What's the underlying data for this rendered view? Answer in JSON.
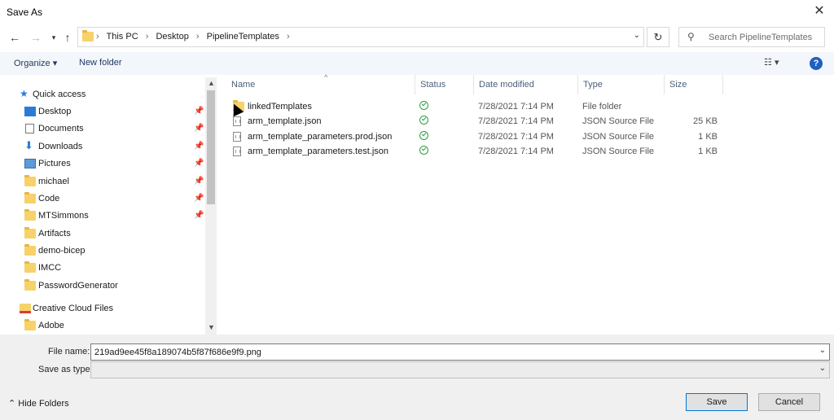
{
  "window": {
    "title": "Save As"
  },
  "navigation": {
    "breadcrumbs": [
      "This PC",
      "Desktop",
      "PipelineTemplates"
    ],
    "search_placeholder": "Search PipelineTemplates"
  },
  "toolbar": {
    "organize_label": "Organize",
    "new_folder_label": "New folder"
  },
  "sidebar": {
    "items": [
      {
        "label": "Quick access",
        "icon": "star-icon",
        "pinned": false
      },
      {
        "label": "Desktop",
        "icon": "desktop-icon",
        "pinned": true
      },
      {
        "label": "Documents",
        "icon": "documents-icon",
        "pinned": true
      },
      {
        "label": "Downloads",
        "icon": "downloads-icon",
        "pinned": true
      },
      {
        "label": "Pictures",
        "icon": "pictures-icon",
        "pinned": true
      },
      {
        "label": "michael",
        "icon": "folder-icon",
        "pinned": true
      },
      {
        "label": "Code",
        "icon": "folder-icon",
        "pinned": true
      },
      {
        "label": "MTSimmons",
        "icon": "folder-icon",
        "pinned": true
      },
      {
        "label": "Artifacts",
        "icon": "folder-icon",
        "pinned": false
      },
      {
        "label": "demo-bicep",
        "icon": "folder-icon",
        "pinned": false
      },
      {
        "label": "IMCC",
        "icon": "folder-icon",
        "pinned": false
      },
      {
        "label": "PasswordGenerator",
        "icon": "folder-icon",
        "pinned": false
      },
      {
        "label": "Creative Cloud Files",
        "icon": "creative-cloud-icon",
        "pinned": false
      },
      {
        "label": "Adobe",
        "icon": "folder-sync-icon",
        "pinned": false
      }
    ]
  },
  "filelist": {
    "columns": [
      "Name",
      "Status",
      "Date modified",
      "Type",
      "Size"
    ],
    "rows": [
      {
        "name": "linkedTemplates",
        "icon": "folder-icon",
        "date": "7/28/2021 7:14 PM",
        "type": "File folder",
        "size": ""
      },
      {
        "name": "arm_template.json",
        "icon": "file-icon",
        "date": "7/28/2021 7:14 PM",
        "type": "JSON Source File",
        "size": "25 KB"
      },
      {
        "name": "arm_template_parameters.prod.json",
        "icon": "file-icon",
        "date": "7/28/2021 7:14 PM",
        "type": "JSON Source File",
        "size": "1 KB"
      },
      {
        "name": "arm_template_parameters.test.json",
        "icon": "file-icon",
        "date": "7/28/2021 7:14 PM",
        "type": "JSON Source File",
        "size": "1 KB"
      }
    ]
  },
  "bottom": {
    "file_name_label": "File name:",
    "file_name_value": "219ad9ee45f8a189074b5f87f686e9f9.png",
    "save_as_type_label": "Save as type:",
    "save_as_type_value": "",
    "hide_folders_label": "Hide Folders",
    "save_label": "Save",
    "cancel_label": "Cancel"
  }
}
